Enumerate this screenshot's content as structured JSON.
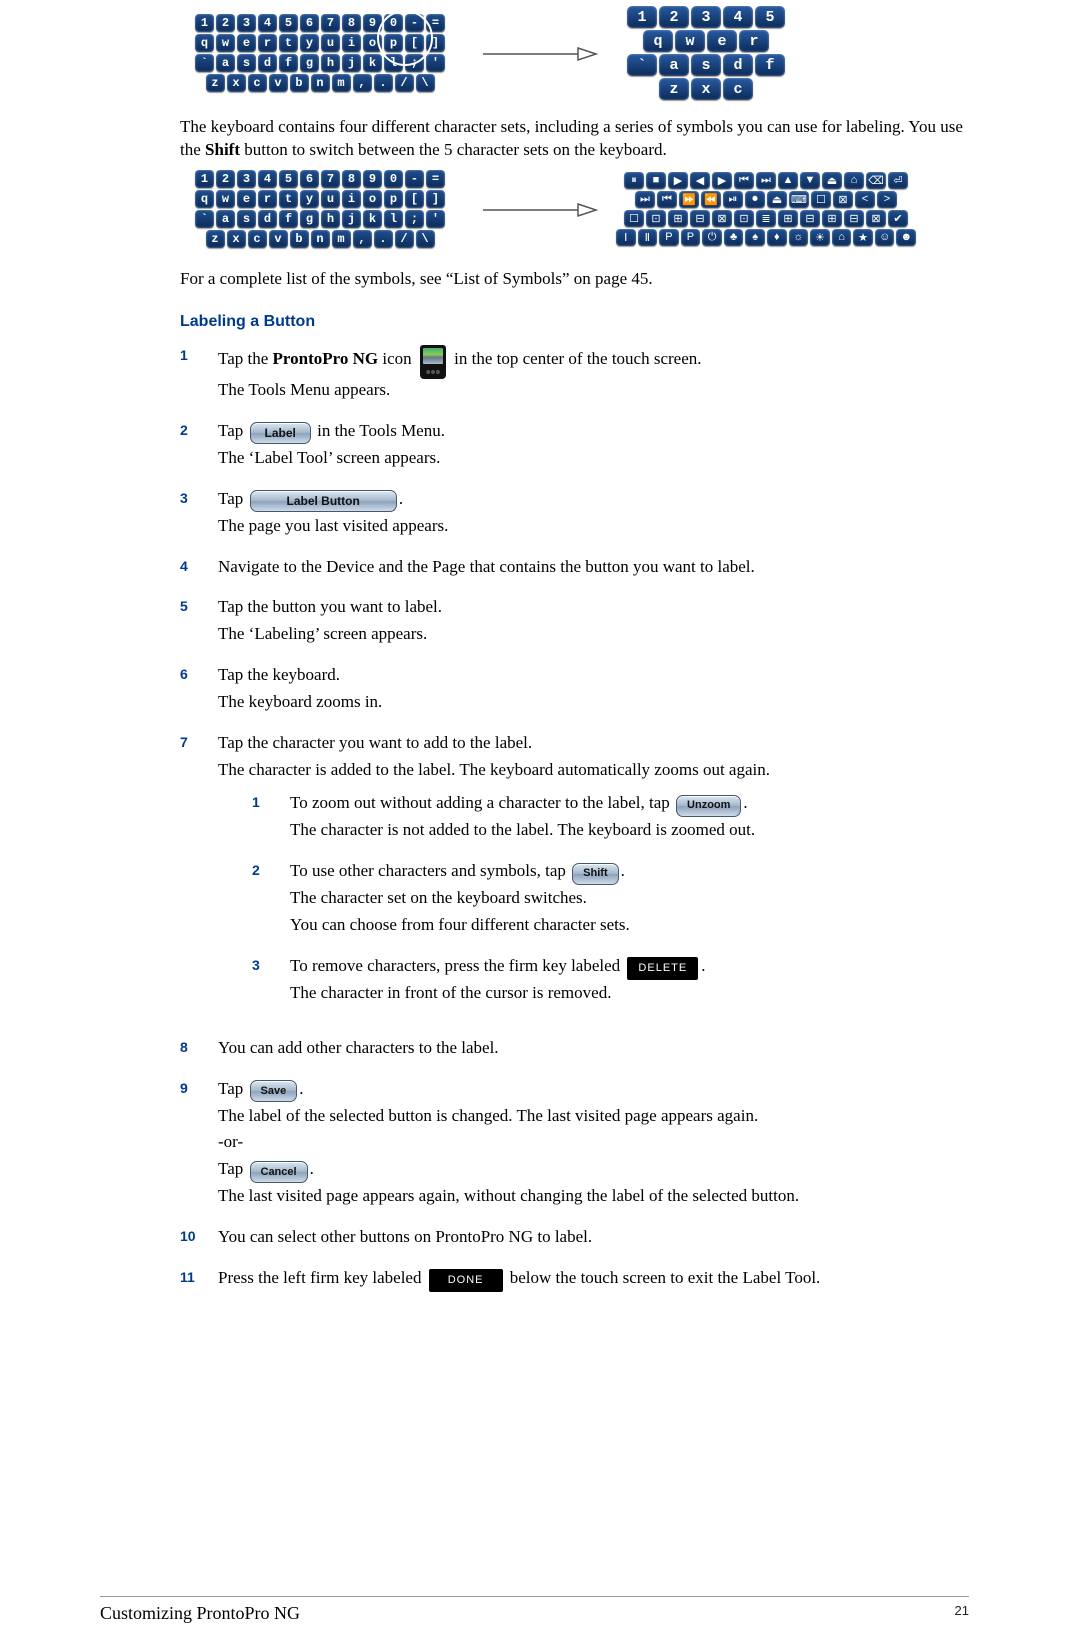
{
  "footer": {
    "title": "Customizing ProntoPro NG",
    "page": "21"
  },
  "intro1": "The keyboard contains four different character sets, including a series of symbols you can use for labeling. You use the ",
  "intro1_bold": "Shift",
  "intro1_tail": " button to switch between the 5 character sets on the keyboard.",
  "intro2": "For a complete list of the symbols, see “List of Symbols” on page 45.",
  "section_heading": "Labeling a Button",
  "kb_rows": [
    [
      "1",
      "2",
      "3",
      "4",
      "5",
      "6",
      "7",
      "8",
      "9",
      "0",
      "-",
      "="
    ],
    [
      "q",
      "w",
      "e",
      "r",
      "t",
      "y",
      "u",
      "i",
      "o",
      "p",
      "[",
      "]"
    ],
    [
      "`",
      "a",
      "s",
      "d",
      "f",
      "g",
      "h",
      "j",
      "k",
      "l",
      ";",
      "'"
    ],
    [
      "z",
      "x",
      "c",
      "v",
      "b",
      "n",
      "m",
      ",",
      ".",
      "/",
      "\\"
    ]
  ],
  "kb_zoom_rows": [
    [
      "1",
      "2",
      "3",
      "4",
      "5"
    ],
    [
      "q",
      "w",
      "e",
      "r"
    ],
    [
      "`",
      "a",
      "s",
      "d",
      "f"
    ],
    [
      "z",
      "x",
      "c"
    ]
  ],
  "sym_rows": [
    [
      "⏸",
      "■",
      "▶",
      "◀",
      "▶",
      "⏮",
      "⏭",
      "▲",
      "▼",
      "⏏",
      "⌂",
      "⌫",
      "⏎"
    ],
    [
      "⏭",
      "⏮",
      "⏩",
      "⏪",
      "⏯",
      "⏺",
      "⏏",
      "⌨",
      "☐",
      "⊠",
      "<",
      ">"
    ],
    [
      "☐",
      "⊡",
      "⊞",
      "⊟",
      "⊠",
      "⊡",
      "≣",
      "⊞",
      "⊟",
      "⊞",
      "⊟",
      "⊠",
      "✔"
    ],
    [
      "Ⅰ",
      "Ⅱ",
      "P",
      "P",
      "⏻",
      "♣",
      "♠",
      "♦",
      "☼",
      "☀",
      "⌂",
      "★",
      "☺",
      "☻"
    ]
  ],
  "buttons": {
    "label": "Label",
    "label_button": "Label Button",
    "unzoom": "Unzoom",
    "shift": "Shift",
    "delete": "DELETE",
    "save": "Save",
    "cancel": "Cancel",
    "done": "DONE"
  },
  "steps": {
    "s1": {
      "num": "1",
      "a": "Tap the ",
      "bold": "ProntoPro NG",
      "b": " icon ",
      "c": " in the top center of the touch screen.",
      "after": "The Tools Menu appears."
    },
    "s2": {
      "num": "2",
      "a": "Tap ",
      "c": " in the Tools Menu.",
      "after": "The ‘Label Tool’ screen appears."
    },
    "s3": {
      "num": "3",
      "a": "Tap ",
      "c": ".",
      "after": "The page you last visited appears."
    },
    "s4": {
      "num": "4",
      "a": "Navigate to the Device and the Page that contains the button you want to label."
    },
    "s5": {
      "num": "5",
      "a": "Tap the button you want to label.",
      "after": "The ‘Labeling’ screen appears."
    },
    "s6": {
      "num": "6",
      "a": "Tap the keyboard.",
      "after": "The keyboard zooms in."
    },
    "s7": {
      "num": "7",
      "a": "Tap the character you want to add to the label.",
      "after": "The character is added to the label. The keyboard automatically zooms out again."
    },
    "sub1": {
      "num": "1",
      "a": "To zoom out without adding a character to the label, tap ",
      "c": ".",
      "after": "The character is not added to the label. The keyboard is zoomed out."
    },
    "sub2": {
      "num": "2",
      "a": "To use other characters and symbols, tap ",
      "c": ".",
      "after1": "The character set on the keyboard switches.",
      "after2": "You can choose from four different character sets."
    },
    "sub3": {
      "num": "3",
      "a": "To remove characters, press the firm key labeled ",
      "c": ".",
      "after": "The character in front of the cursor is removed."
    },
    "s8": {
      "num": "8",
      "a": "You can add other characters to the label."
    },
    "s9": {
      "num": "9",
      "a": "Tap ",
      "c": ".",
      "after1": "The label of the selected button is changed. The last visited page appears again.",
      "or": "-or-",
      "d": "Tap ",
      "e": ".",
      "after2": "The last visited page appears again, without changing the label of the selected button."
    },
    "s10": {
      "num": "10",
      "a": "You can select other buttons on ProntoPro NG to label."
    },
    "s11": {
      "num": "11",
      "a": "Press the left firm key labeled ",
      "c": " below the touch screen to exit the Label Tool."
    }
  }
}
